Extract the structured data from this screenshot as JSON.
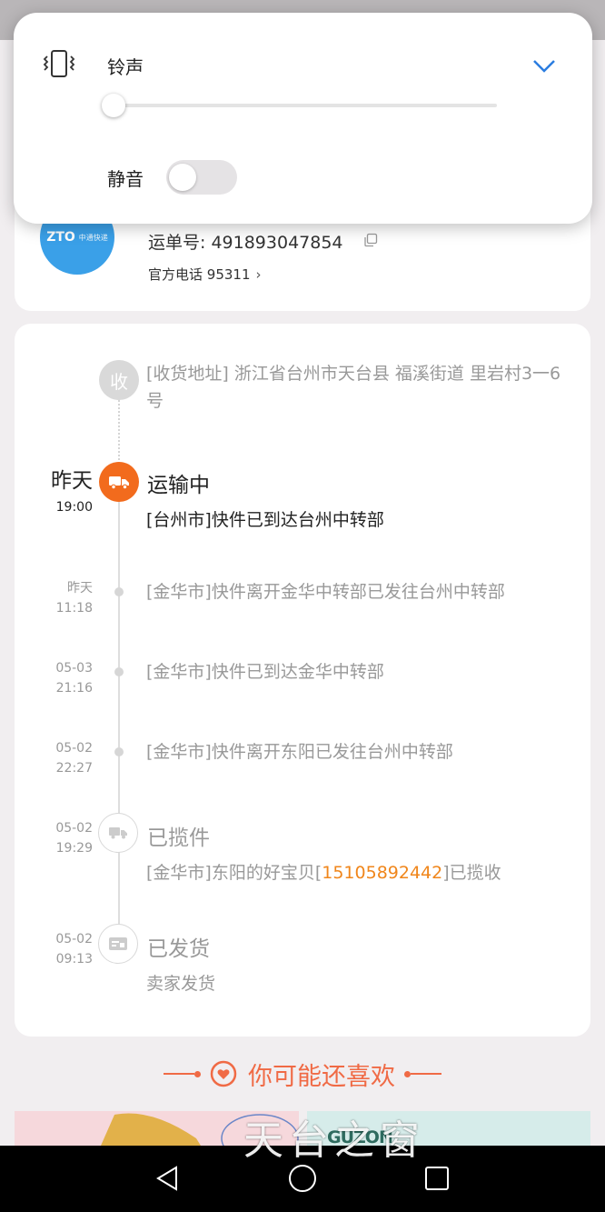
{
  "volume_panel": {
    "ringtone_label": "铃声",
    "ringtone_level": 0,
    "mute_label": "静音",
    "mute_on": false,
    "icons": {
      "mode": "vibrate-icon",
      "expand": "chevron-down-icon"
    }
  },
  "courier": {
    "logo_text": "ZTO",
    "logo_sub": "中通快递",
    "waybill_label": "运单号:",
    "waybill_number": "491893047854",
    "phone_label": "官方电话",
    "phone_number": "95311",
    "colors": {
      "logo_bg": "#3aa0e8"
    }
  },
  "timeline": {
    "address": {
      "badge": "收",
      "text": "[收货地址] 浙江省台州市天台县 福溪街道   里岩村3一6号"
    },
    "current": {
      "date": "昨天",
      "time": "19:00",
      "status": "运输中",
      "text": "[台州市]快件已到达台州中转部",
      "icon": "truck-icon",
      "color": "#f26b1d"
    },
    "events": [
      {
        "date": "昨天",
        "time": "11:18",
        "text": "[金华市]快件离开金华中转部已发往台州中转部"
      },
      {
        "date": "05-03",
        "time": "21:16",
        "text": "[金华市]快件已到达金华中转部"
      },
      {
        "date": "05-02",
        "time": "22:27",
        "text": "[金华市]快件离开东阳已发往台州中转部"
      }
    ],
    "picked_up": {
      "date": "05-02",
      "time": "19:29",
      "status": "已揽件",
      "text_prefix": "[金华市]东阳的好宝贝[",
      "phone": "15105892442",
      "text_suffix": "]已揽收",
      "icon": "pickup-truck-icon"
    },
    "shipped": {
      "date": "05-02",
      "time": "09:13",
      "status": "已发货",
      "text": "卖家发货",
      "icon": "package-icon"
    }
  },
  "recommend": {
    "title": "你可能还喜欢",
    "accent": "#f06a45"
  },
  "products": [
    {
      "brand": ""
    },
    {
      "brand": "GUZON"
    }
  ],
  "watermark": "天台之窗",
  "nav": {
    "back": "back-triangle-icon",
    "home": "home-circle-icon",
    "recent": "recent-square-icon"
  }
}
